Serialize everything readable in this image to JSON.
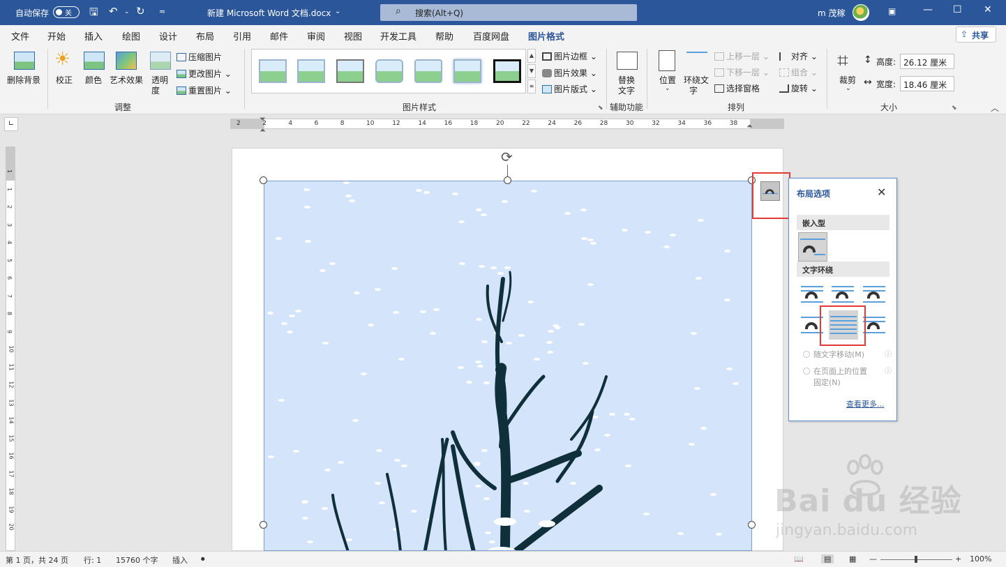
{
  "titlebar": {
    "autosave_label": "自动保存",
    "autosave_state": "关",
    "doc_title": "新建 Microsoft Word 文档.docx",
    "search_placeholder": "搜索(Alt+Q)",
    "user_name": "m 茂稼",
    "icons": [
      "save-icon",
      "undo-icon",
      "redo-icon",
      "customize-icon",
      "search-icon",
      "minimize-icon",
      "maximize-icon",
      "close-icon",
      "ribbon-display-icon"
    ]
  },
  "tabs": [
    "文件",
    "开始",
    "插入",
    "绘图",
    "设计",
    "布局",
    "引用",
    "邮件",
    "审阅",
    "视图",
    "开发工具",
    "帮助",
    "百度网盘",
    "图片格式"
  ],
  "active_tab": "图片格式",
  "share_label": "共享",
  "ribbon": {
    "adjust": {
      "remove_bg": "删除背景",
      "correct": "校正",
      "color": "颜色",
      "art_effects": "艺术效果",
      "transparency_1": "透明",
      "transparency_2": "度",
      "compress": "压缩图片",
      "change": "更改图片",
      "reset": "重置图片",
      "group": "调整"
    },
    "styles": {
      "border": "图片边框",
      "effects": "图片效果",
      "layout": "图片版式",
      "group": "图片样式"
    },
    "accessibility": {
      "alt_1": "替换",
      "alt_2": "文字",
      "group": "辅助功能"
    },
    "arrange": {
      "position": "位置",
      "wrap_1": "环绕文",
      "wrap_2": "字",
      "forward": "上移一层",
      "backward": "下移一层",
      "selection_pane": "选择窗格",
      "align": "对齐",
      "group_btn": "组合",
      "rotate": "旋转",
      "group": "排列"
    },
    "size": {
      "crop": "裁剪",
      "height_label": "高度:",
      "height_value": "26.12 厘米",
      "width_label": "宽度:",
      "width_value": "18.46 厘米",
      "group": "大小"
    }
  },
  "ruler": {
    "numbers": [
      "2",
      "2",
      "4",
      "6",
      "8",
      "10",
      "12",
      "14",
      "16",
      "18",
      "20",
      "22",
      "24",
      "26",
      "28",
      "30",
      "32",
      "34",
      "36",
      "38"
    ],
    "vnumbers": [
      "1",
      "1",
      "2",
      "3",
      "4",
      "5",
      "6",
      "7",
      "8",
      "9",
      "10",
      "11",
      "12",
      "13",
      "14",
      "15",
      "16",
      "17",
      "18",
      "19",
      "20"
    ]
  },
  "layout_pane": {
    "title": "布局选项",
    "inline_section": "嵌入型",
    "wrap_section": "文字环绕",
    "move_with_text": "随文字移动(M)",
    "fix_position_1": "在页面上的位置",
    "fix_position_2": "固定(N)",
    "see_more": "查看更多..."
  },
  "status": {
    "page": "第 1 页，共 24 页",
    "line": "行: 1",
    "words": "15760 个字",
    "mode": "插入",
    "zoom": "100%"
  },
  "watermark": {
    "brand": "Bai du 经验",
    "url": "jingyan.baidu.com"
  },
  "colors": {
    "title_bar": "#2b579a",
    "image_bg": "#d4e4fa",
    "highlight_red": "#e53935"
  }
}
